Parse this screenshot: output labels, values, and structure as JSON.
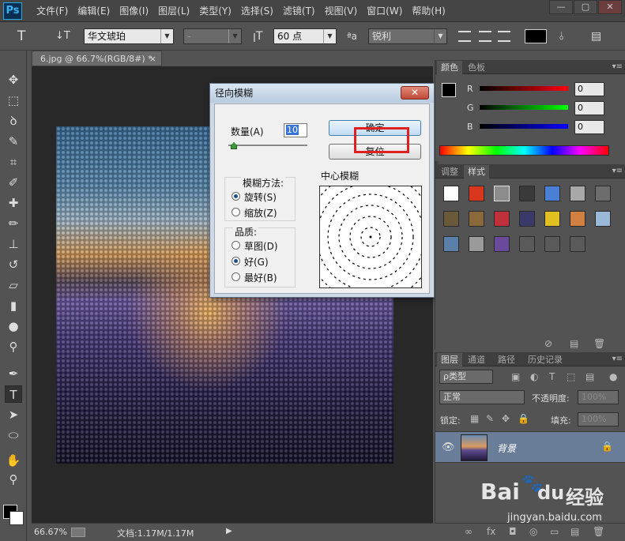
{
  "app": {
    "logo": "Ps",
    "menu": [
      "文件(F)",
      "编辑(E)",
      "图像(I)",
      "图层(L)",
      "类型(Y)",
      "选择(S)",
      "滤镜(T)",
      "视图(V)",
      "窗口(W)",
      "帮助(H)"
    ],
    "window_buttons": [
      "—",
      "▢",
      "✕"
    ]
  },
  "options_bar": {
    "font_family": "华文琥珀",
    "font_style": "-",
    "font_size": "60 点",
    "aa_label": "ªa",
    "antialias": "锐利"
  },
  "document": {
    "tab_title": "6.jpg @ 66.7%(RGB/8#) *",
    "tab_close": "×",
    "zoom": "66.67%",
    "doc_size": "文档:1.17M/1.17M"
  },
  "dialog": {
    "title": "径向模糊",
    "close": "✕",
    "amount_label": "数量(A)",
    "amount_value": "10",
    "ok_button": "确定",
    "reset_button": "复位",
    "method_label": "模糊方法:",
    "method_options": [
      "旋转(S)",
      "缩放(Z)"
    ],
    "method_selected": 0,
    "quality_label": "品质:",
    "quality_options": [
      "草图(D)",
      "好(G)",
      "最好(B)"
    ],
    "quality_selected": 1,
    "center_label": "中心模糊"
  },
  "color_panel": {
    "tabs": [
      "颜色",
      "色板"
    ],
    "channels": [
      {
        "label": "R",
        "value": "0",
        "gradient": "#ff0000"
      },
      {
        "label": "G",
        "value": "0",
        "gradient": "#00ff00"
      },
      {
        "label": "B",
        "value": "0",
        "gradient": "#0000ff"
      }
    ]
  },
  "styles_panel": {
    "tabs": [
      "调整",
      "样式"
    ],
    "swatches": [
      "#ffffff",
      "#d9361e",
      "#8c8c8c",
      "#3a3a3a",
      "#4a7fd6",
      "#a8a8a8",
      "#6d6d6d",
      "#6b5a3a",
      "#8a6a3a",
      "#c0303a",
      "#3a3a6a",
      "#e0c020",
      "#d08040",
      "#9ab8d8",
      "#5a7fa8",
      "#9a9a9a",
      "#6a4a9a",
      "#5a5a5a",
      "#5a5a5a",
      "#5a5a5a"
    ]
  },
  "layers_panel": {
    "tabs": [
      "图层",
      "通道",
      "路径",
      "历史记录"
    ],
    "filter_kind": "ρ类型",
    "blend_mode": "正常",
    "opacity_label": "不透明度:",
    "opacity_value": "100%",
    "lock_label": "锁定:",
    "fill_label": "填充:",
    "fill_value": "100%",
    "layer_name": "背景",
    "footer_icons": [
      "∞",
      "fx",
      "◘",
      "◎",
      "▭",
      "▤",
      "🗑"
    ]
  },
  "watermark": {
    "brand": "Bai",
    "brand2": "du",
    "cn": "经验",
    "url": "jingyan.baidu.com"
  }
}
